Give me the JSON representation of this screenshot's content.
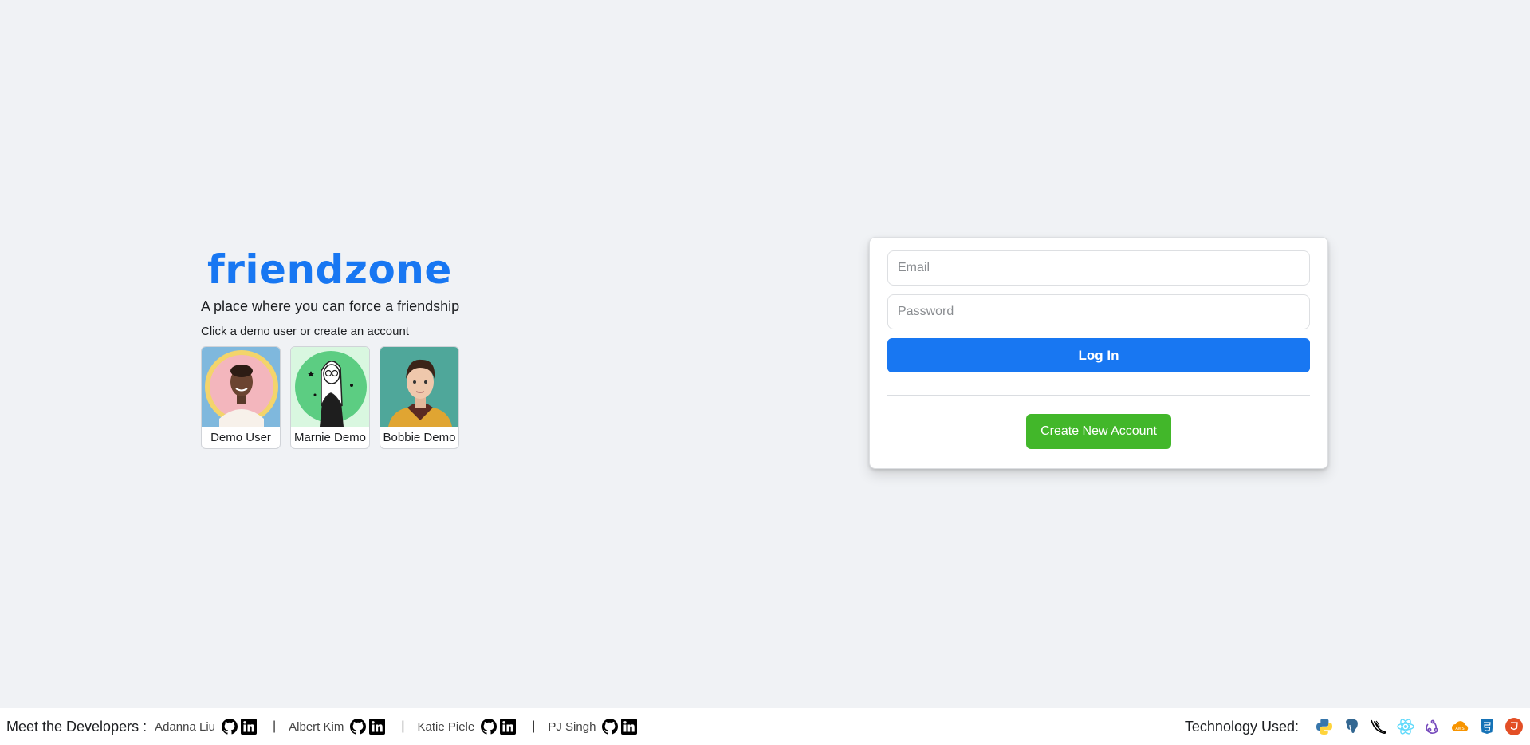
{
  "brand": {
    "name": "friendzone",
    "color": "#1877f2"
  },
  "intro": {
    "tagline": "A place where you can force a friendship",
    "hint": "Click a demo user or create an account"
  },
  "demo_users": [
    {
      "name": "Demo User",
      "avatar_icon": "woman-portrait-avatar"
    },
    {
      "name": "Marnie Demo",
      "avatar_icon": "illustrated-woman-avatar"
    },
    {
      "name": "Bobbie Demo",
      "avatar_icon": "man-portrait-avatar"
    }
  ],
  "login": {
    "email_placeholder": "Email",
    "password_placeholder": "Password",
    "login_label": "Log In",
    "create_label": "Create New Account",
    "login_color": "#1877f2",
    "create_color": "#42b72a"
  },
  "footer": {
    "meet_label": "Meet the Developers :",
    "developers": [
      {
        "name": "Adanna Liu"
      },
      {
        "name": "Albert Kim"
      },
      {
        "name": "Katie Piele"
      },
      {
        "name": "PJ Singh"
      }
    ],
    "separator": "|",
    "tech_label": "Technology Used:",
    "tech_icons": [
      "python-icon",
      "postgresql-icon",
      "flask-icon",
      "react-icon",
      "redux-icon",
      "aws-icon",
      "css3-icon",
      "html5-icon"
    ]
  }
}
